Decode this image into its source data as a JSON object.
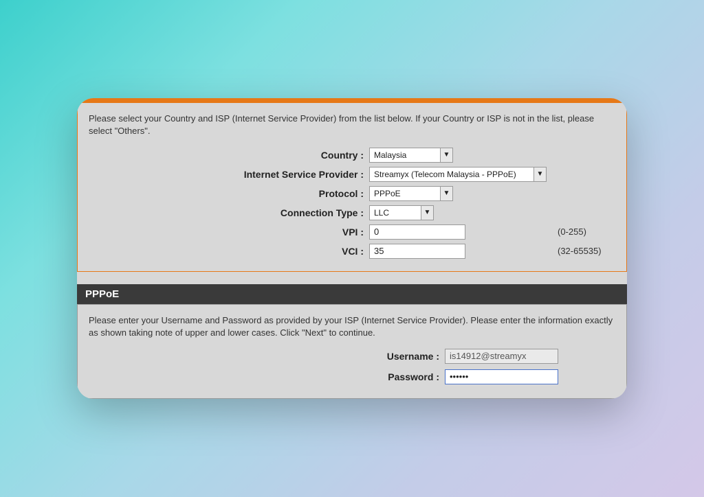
{
  "isp_panel": {
    "intro": "Please select your Country and ISP (Internet Service Provider) from the list below. If your Country or ISP is not in the list, please select \"Others\".",
    "labels": {
      "country": "Country :",
      "isp": "Internet Service Provider :",
      "protocol": "Protocol :",
      "conn_type": "Connection Type :",
      "vpi": "VPI :",
      "vci": "VCI :"
    },
    "values": {
      "country": "Malaysia",
      "isp": "Streamyx (Telecom Malaysia - PPPoE)",
      "protocol": "PPPoE",
      "conn_type": "LLC",
      "vpi": "0",
      "vci": "35"
    },
    "hints": {
      "vpi": "(0-255)",
      "vci": "(32-65535)"
    }
  },
  "pppoe_panel": {
    "header": "PPPoE",
    "intro": "Please enter your Username and Password as provided by your ISP (Internet Service Provider). Please enter the information exactly as shown taking note of upper and lower cases. Click \"Next\" to continue.",
    "labels": {
      "username": "Username :",
      "password": "Password :"
    },
    "values": {
      "username": "is14912@streamyx",
      "password": "••••••"
    }
  }
}
